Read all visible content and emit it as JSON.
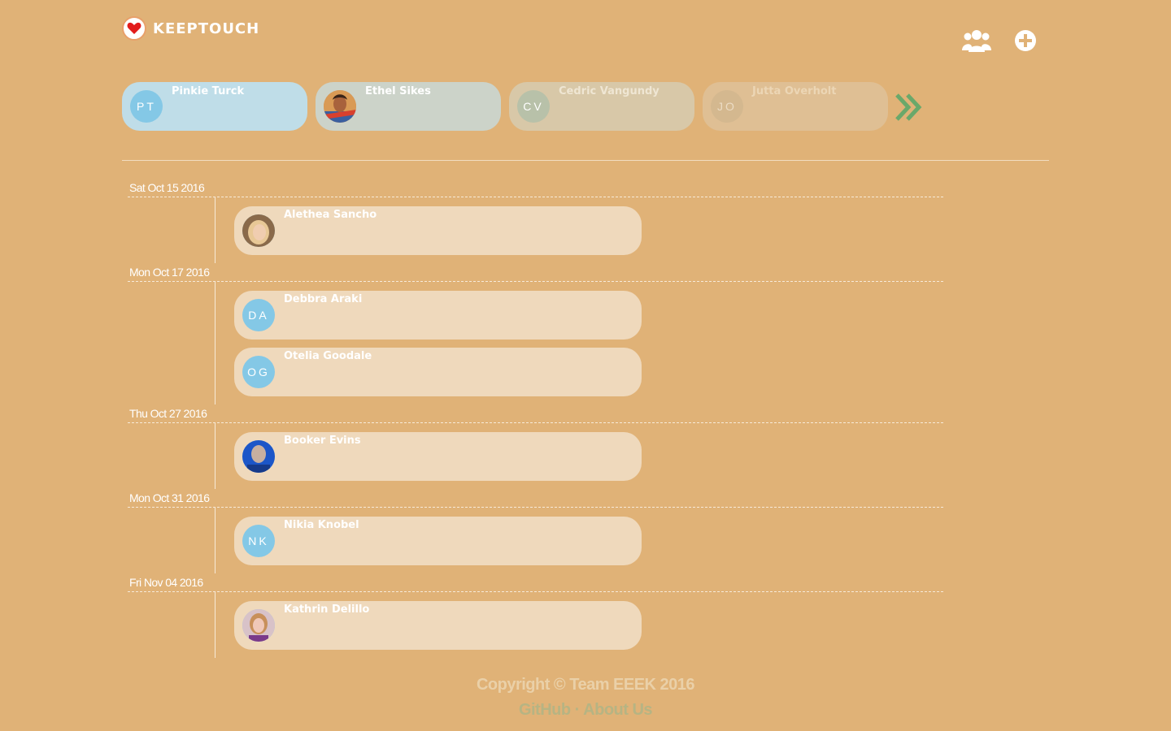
{
  "app": {
    "name": "KEEPTOUCH"
  },
  "header": {
    "group_icon": "group-icon",
    "add_icon": "plus-circle-icon"
  },
  "favorites": [
    {
      "name": "Pinkie Turck",
      "initials": "PT",
      "has_photo": false,
      "color": "#bfdde8"
    },
    {
      "name": "Ethel Sikes",
      "initials": "",
      "has_photo": true,
      "color": "#ccd3c9"
    },
    {
      "name": "Cedric Vangundy",
      "initials": "CV",
      "has_photo": false,
      "color": "#d8c8a8"
    },
    {
      "name": "Jutta Overholt",
      "initials": "JO",
      "has_photo": false,
      "color": "#dfbf94"
    }
  ],
  "timeline": [
    {
      "date": "Sat Oct 15 2016",
      "entries": [
        {
          "name": "Alethea Sancho",
          "initials": "",
          "has_photo": true,
          "photo": "blonde"
        }
      ]
    },
    {
      "date": "Mon Oct 17 2016",
      "entries": [
        {
          "name": "Debbra Araki",
          "initials": "DA",
          "has_photo": false
        },
        {
          "name": "Otelia Goodale",
          "initials": "OG",
          "has_photo": false
        }
      ]
    },
    {
      "date": "Thu Oct 27 2016",
      "entries": [
        {
          "name": "Booker Evins",
          "initials": "",
          "has_photo": true,
          "photo": "blue"
        }
      ]
    },
    {
      "date": "Mon Oct 31 2016",
      "entries": [
        {
          "name": "Nikia Knobel",
          "initials": "NK",
          "has_photo": false
        }
      ]
    },
    {
      "date": "Fri Nov 04 2016",
      "entries": [
        {
          "name": "Kathrin Delillo",
          "initials": "",
          "has_photo": true,
          "photo": "woman"
        }
      ]
    }
  ],
  "footer": {
    "copyright": "Copyright © Team EEEK 2016",
    "links": [
      "GitHub",
      "About Us"
    ],
    "separator": "·"
  },
  "colors": {
    "background": "#e0b277",
    "avatar": "#84c8e6",
    "card": "#efd9bc",
    "next_arrow": "#6aa86a"
  }
}
